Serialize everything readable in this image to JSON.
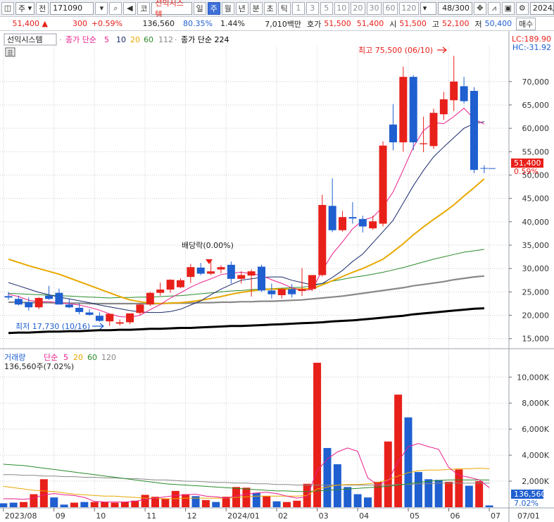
{
  "toolbar": {
    "market": "주",
    "market_type": "전",
    "code": "171090",
    "index_btn": "코",
    "stock_name": "선익시스템",
    "periods": [
      "일",
      "주",
      "월",
      "년",
      "분",
      "초",
      "틱"
    ],
    "active_period": "주",
    "counts": [
      "1",
      "3",
      "5",
      "10",
      "20",
      "30",
      "60",
      "120"
    ],
    "page": "48/300",
    "date": "2024/"
  },
  "quote": {
    "price": "51,400",
    "change": "300",
    "change_rate": "+0.59%",
    "volume": "136,560",
    "vol_ratio": "80.35%",
    "turnover": "1.44%",
    "amount": "7,010백만",
    "bid_label": "호가",
    "bid": "51,500",
    "ask": "51,400",
    "open_label": "시",
    "open": "51,500",
    "high_label": "고",
    "high": "52,100",
    "low_label": "저",
    "low": "50,400",
    "order_button": "매수"
  },
  "main_chart": {
    "name_tag": "선익시스템",
    "ma_legend_prefix": "종가 단순",
    "ma_periods": [
      "5",
      "10",
      "20",
      "60",
      "112"
    ],
    "ma_long_label": "종가 단순 224",
    "lc_label": "LC:189.90",
    "hc_label": "HC:-31.92",
    "current_price_tag": "51,400",
    "current_rate_tag": "0.59%",
    "high_annotation": "최고 75,500 (06/10)",
    "low_annotation": "최저 17,730 (10/16)",
    "dividend_annotation": "배당락(0.00%)",
    "y_ticks": [
      "70,000",
      "65,000",
      "60,000",
      "55,000",
      "50,000",
      "45,000",
      "40,000",
      "35,000",
      "30,000",
      "25,000",
      "20,000",
      "15,000"
    ]
  },
  "volume_chart": {
    "title": "거래량",
    "ma_label": "단순",
    "ma_periods": [
      "5",
      "20",
      "60",
      "120"
    ],
    "current": "136,560주(7.02%)",
    "current_tag": "136,560",
    "current_rate_tag": "7.02%",
    "y_ticks": [
      "10,000K",
      "8,000K",
      "6,000K",
      "4,000K",
      "2,000K"
    ]
  },
  "x_axis": {
    "labels": [
      "2023/08",
      "09",
      "10",
      "11",
      "12",
      "2024/01",
      "02",
      "03",
      "04",
      "05",
      "06",
      "07",
      "07/01"
    ]
  },
  "colors": {
    "up": "#e8201a",
    "down": "#1f5fd0",
    "ma5": "#e91e8c",
    "ma10": "#1a2a6b",
    "ma20": "#e8a800",
    "ma60": "#2a8c2a",
    "ma112": "#888888",
    "ma224": "#000000"
  },
  "chart_data": {
    "type": "candlestick",
    "period": "weekly",
    "candles": [
      {
        "o": 24100,
        "h": 25000,
        "l": 23300,
        "c": 23800
      },
      {
        "o": 23500,
        "h": 24200,
        "l": 22100,
        "c": 22300
      },
      {
        "o": 22800,
        "h": 23800,
        "l": 21000,
        "c": 21700
      },
      {
        "o": 21700,
        "h": 23900,
        "l": 21300,
        "c": 23700
      },
      {
        "o": 24200,
        "h": 26300,
        "l": 23300,
        "c": 23500
      },
      {
        "o": 24800,
        "h": 25700,
        "l": 22600,
        "c": 22300
      },
      {
        "o": 22300,
        "h": 23600,
        "l": 21500,
        "c": 21700
      },
      {
        "o": 21600,
        "h": 22600,
        "l": 20200,
        "c": 20700
      },
      {
        "o": 20600,
        "h": 21300,
        "l": 19900,
        "c": 20100
      },
      {
        "o": 19900,
        "h": 20600,
        "l": 18600,
        "c": 18800
      },
      {
        "o": 18700,
        "h": 20300,
        "l": 17730,
        "c": 20300
      },
      {
        "o": 18200,
        "h": 19100,
        "l": 17800,
        "c": 18500
      },
      {
        "o": 18500,
        "h": 20400,
        "l": 18100,
        "c": 20400
      },
      {
        "o": 20500,
        "h": 22500,
        "l": 20100,
        "c": 22300
      },
      {
        "o": 22300,
        "h": 25000,
        "l": 22000,
        "c": 24800
      },
      {
        "o": 24800,
        "h": 27000,
        "l": 24200,
        "c": 25500
      },
      {
        "o": 25500,
        "h": 27700,
        "l": 24800,
        "c": 27600
      },
      {
        "o": 26000,
        "h": 27900,
        "l": 25800,
        "c": 27500
      },
      {
        "o": 28200,
        "h": 31000,
        "l": 26900,
        "c": 30300
      },
      {
        "o": 30200,
        "h": 31200,
        "l": 28600,
        "c": 28900
      },
      {
        "o": 28900,
        "h": 31600,
        "l": 28600,
        "c": 29400
      },
      {
        "o": 29800,
        "h": 30700,
        "l": 29000,
        "c": 30300
      },
      {
        "o": 30800,
        "h": 31500,
        "l": 26800,
        "c": 27800
      },
      {
        "o": 27800,
        "h": 29400,
        "l": 26800,
        "c": 28600
      },
      {
        "o": 28500,
        "h": 29800,
        "l": 24000,
        "c": 29400
      },
      {
        "o": 30400,
        "h": 30800,
        "l": 25000,
        "c": 25300
      },
      {
        "o": 25300,
        "h": 26800,
        "l": 23600,
        "c": 24500
      },
      {
        "o": 24300,
        "h": 25800,
        "l": 23600,
        "c": 25600
      },
      {
        "o": 25600,
        "h": 26700,
        "l": 23800,
        "c": 24500
      },
      {
        "o": 25200,
        "h": 30100,
        "l": 24100,
        "c": 25600
      },
      {
        "o": 25600,
        "h": 28600,
        "l": 25200,
        "c": 28600
      },
      {
        "o": 28600,
        "h": 45800,
        "l": 28300,
        "c": 43600
      },
      {
        "o": 43400,
        "h": 49300,
        "l": 37800,
        "c": 38200
      },
      {
        "o": 38200,
        "h": 42300,
        "l": 37900,
        "c": 41000
      },
      {
        "o": 41000,
        "h": 44200,
        "l": 39600,
        "c": 40700
      },
      {
        "o": 40600,
        "h": 41300,
        "l": 37700,
        "c": 39000
      },
      {
        "o": 38600,
        "h": 41300,
        "l": 38300,
        "c": 40100
      },
      {
        "o": 39600,
        "h": 57200,
        "l": 39000,
        "c": 56300
      },
      {
        "o": 60800,
        "h": 65200,
        "l": 55300,
        "c": 57000
      },
      {
        "o": 57000,
        "h": 73200,
        "l": 55000,
        "c": 71000
      },
      {
        "o": 71000,
        "h": 71400,
        "l": 55300,
        "c": 57000
      },
      {
        "o": 56600,
        "h": 62500,
        "l": 54900,
        "c": 56800
      },
      {
        "o": 56200,
        "h": 64200,
        "l": 55600,
        "c": 63300
      },
      {
        "o": 63000,
        "h": 67800,
        "l": 61800,
        "c": 66200
      },
      {
        "o": 66000,
        "h": 75500,
        "l": 63700,
        "c": 70000
      },
      {
        "o": 69000,
        "h": 71000,
        "l": 65300,
        "c": 65800
      },
      {
        "o": 68000,
        "h": 68800,
        "l": 50400,
        "c": 51100
      },
      {
        "o": 51500,
        "h": 52100,
        "l": 50400,
        "c": 51400
      }
    ],
    "ma": {
      "5": [
        24500,
        24000,
        23200,
        22900,
        22900,
        22700,
        22500,
        22200,
        21700,
        21100,
        20300,
        19700,
        19600,
        20000,
        21200,
        22300,
        23700,
        24800,
        26000,
        27000,
        27800,
        28700,
        29000,
        29200,
        28900,
        28500,
        27600,
        26800,
        25900,
        25300,
        25500,
        29600,
        33100,
        35700,
        38500,
        40300,
        41000,
        43200,
        46400,
        51100,
        56000,
        59500,
        61200,
        61000,
        62500,
        64300,
        62000,
        60900
      ],
      "10": [
        27000,
        26300,
        25600,
        24900,
        24400,
        23900,
        23500,
        23100,
        22700,
        22200,
        21800,
        21400,
        21000,
        20700,
        20600,
        20600,
        20800,
        21300,
        22200,
        23100,
        24400,
        25600,
        26600,
        27500,
        27800,
        28100,
        28200,
        28200,
        27500,
        27000,
        26500,
        26800,
        28100,
        29600,
        31500,
        33100,
        35500,
        37900,
        40300,
        44000,
        47700,
        51000,
        53900,
        56000,
        58000,
        60000,
        61000,
        61400
      ],
      "20": [
        32000,
        31300,
        30600,
        30000,
        29400,
        28800,
        28000,
        27200,
        26400,
        25600,
        24800,
        24000,
        23300,
        22900,
        22600,
        22500,
        22600,
        22700,
        22900,
        23200,
        23600,
        24000,
        24500,
        24900,
        25200,
        25500,
        25600,
        25600,
        25600,
        25600,
        25700,
        26500,
        27400,
        28300,
        29200,
        30000,
        31000,
        32000,
        33600,
        35300,
        37200,
        38900,
        40500,
        42000,
        43600,
        45500,
        47300,
        49200
      ],
      "60": [
        24700,
        24600,
        24500,
        24400,
        24300,
        24200,
        24100,
        24000,
        23900,
        23800,
        23700,
        23800,
        23800,
        23900,
        23900,
        24000,
        24100,
        24200,
        24400,
        24600,
        24800,
        25000,
        25200,
        25300,
        25500,
        25600,
        25700,
        25800,
        25900,
        26000,
        26300,
        26800,
        27300,
        27700,
        28100,
        28400,
        28800,
        29200,
        29700,
        30200,
        30800,
        31400,
        32000,
        32500,
        33000,
        33500,
        33800,
        34100
      ],
      "112": [
        22800,
        22800,
        22700,
        22700,
        22700,
        22600,
        22600,
        22600,
        22500,
        22500,
        22500,
        22500,
        22500,
        22500,
        22500,
        22500,
        22600,
        22600,
        22600,
        22700,
        22700,
        22800,
        22800,
        22900,
        22900,
        23000,
        23000,
        23100,
        23200,
        23300,
        23500,
        23700,
        23900,
        24100,
        24400,
        24700,
        25000,
        25300,
        25600,
        25900,
        26300,
        26600,
        26900,
        27200,
        27600,
        27900,
        28200,
        28400
      ],
      "224": [
        16200,
        16300,
        16300,
        16400,
        16500,
        16500,
        16600,
        16600,
        16700,
        16800,
        16800,
        16900,
        16900,
        17000,
        17100,
        17100,
        17200,
        17300,
        17300,
        17400,
        17500,
        17600,
        17700,
        17700,
        17800,
        17900,
        18000,
        18100,
        18200,
        18300,
        18400,
        18500,
        18700,
        18800,
        18900,
        19100,
        19300,
        19500,
        19700,
        19900,
        20200,
        20400,
        20600,
        20800,
        21000,
        21200,
        21400,
        21500
      ]
    },
    "volume_k": [
      300,
      350,
      400,
      1000,
      2150,
      750,
      200,
      350,
      400,
      400,
      400,
      350,
      400,
      500,
      950,
      800,
      650,
      1250,
      1000,
      850,
      550,
      400,
      800,
      1550,
      1500,
      1100,
      850,
      450,
      400,
      500,
      1800,
      11100,
      4550,
      3300,
      1550,
      1000,
      750,
      1950,
      5050,
      8650,
      6900,
      2700,
      2150,
      2100,
      1950,
      2900,
      1650,
      2000,
      137
    ],
    "volume_up": [
      false,
      false,
      true,
      true,
      true,
      false,
      false,
      true,
      false,
      true,
      true,
      true,
      true,
      true,
      true,
      true,
      true,
      true,
      true,
      false,
      true,
      false,
      true,
      true,
      true,
      false,
      true,
      false,
      true,
      true,
      true,
      true,
      false,
      false,
      false,
      false,
      false,
      true,
      true,
      true,
      false,
      false,
      false,
      false,
      true,
      true,
      false,
      true,
      false
    ],
    "volume_ma": {
      "5": [
        650,
        650,
        600,
        700,
        950,
        1050,
        950,
        900,
        750,
        450,
        400,
        400,
        400,
        450,
        600,
        700,
        800,
        900,
        950,
        1000,
        850,
        800,
        700,
        850,
        1000,
        1100,
        1150,
        1050,
        850,
        700,
        800,
        2800,
        3700,
        4250,
        4550,
        4300,
        2250,
        1700,
        2050,
        3500,
        4650,
        4900,
        4650,
        4450,
        3050,
        2450,
        2300,
        2100,
        1500
      ],
      "20": [
        1600,
        1500,
        1400,
        1300,
        1250,
        1200,
        1100,
        1000,
        950,
        900,
        850,
        850,
        800,
        750,
        700,
        700,
        650,
        650,
        700,
        700,
        700,
        700,
        700,
        750,
        800,
        850,
        850,
        850,
        850,
        850,
        900,
        1400,
        1550,
        1700,
        1750,
        1750,
        1800,
        1900,
        2100,
        2400,
        2650,
        2800,
        2850,
        2850,
        2900,
        2950,
        2950,
        3000,
        2950
      ],
      "60": [
        3300,
        3250,
        3200,
        3100,
        3000,
        2900,
        2800,
        2700,
        2600,
        2500,
        2400,
        2300,
        2200,
        2100,
        2000,
        1900,
        1800,
        1750,
        1700,
        1650,
        1600,
        1550,
        1500,
        1450,
        1400,
        1350,
        1300,
        1250,
        1250,
        1200,
        1200,
        1250,
        1300,
        1350,
        1400,
        1450,
        1500,
        1550,
        1600,
        1700,
        1800,
        1900,
        2000,
        2050,
        2100,
        2100,
        2100,
        2100,
        2100
      ],
      "120": [
        2500,
        2500,
        2450,
        2450,
        2400,
        2400,
        2350,
        2350,
        2300,
        2300,
        2250,
        2250,
        2200,
        2200,
        2150,
        2100,
        2100,
        2050,
        2000,
        2000,
        1950,
        1900,
        1900,
        1850,
        1850,
        1800,
        1800,
        1750,
        1750,
        1700,
        1700,
        1700,
        1700,
        1700,
        1700,
        1700,
        1700,
        1700,
        1700,
        1750,
        1750,
        1800,
        1800,
        1850,
        1850,
        1850,
        1850,
        1850,
        1850
      ]
    },
    "price_ylim": [
      13000,
      77500
    ],
    "volume_ylim": [
      0,
      11800
    ]
  }
}
